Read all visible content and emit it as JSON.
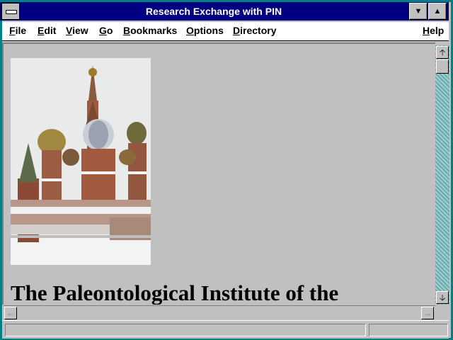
{
  "window": {
    "title": "Research Exchange with PIN",
    "minimize_glyph": "▼",
    "maximize_glyph": "▲"
  },
  "menu": {
    "items": [
      {
        "label": "File",
        "name": "menu-file"
      },
      {
        "label": "Edit",
        "name": "menu-edit"
      },
      {
        "label": "View",
        "name": "menu-view"
      },
      {
        "label": "Go",
        "name": "menu-go"
      },
      {
        "label": "Bookmarks",
        "name": "menu-bookmarks"
      },
      {
        "label": "Options",
        "name": "menu-options"
      },
      {
        "label": "Directory",
        "name": "menu-directory"
      },
      {
        "label": "Help",
        "name": "menu-help"
      }
    ]
  },
  "page": {
    "heading": "The Paleontological Institute of the",
    "image_icon": "cathedral-photo"
  },
  "scrollbars": {
    "up_glyph": "🡡",
    "down_glyph": "🡣",
    "left_glyph": "←",
    "right_glyph": "→"
  },
  "colors": {
    "titlebar": "#000080",
    "desktop": "#008080",
    "chrome": "#c0c0c0"
  }
}
